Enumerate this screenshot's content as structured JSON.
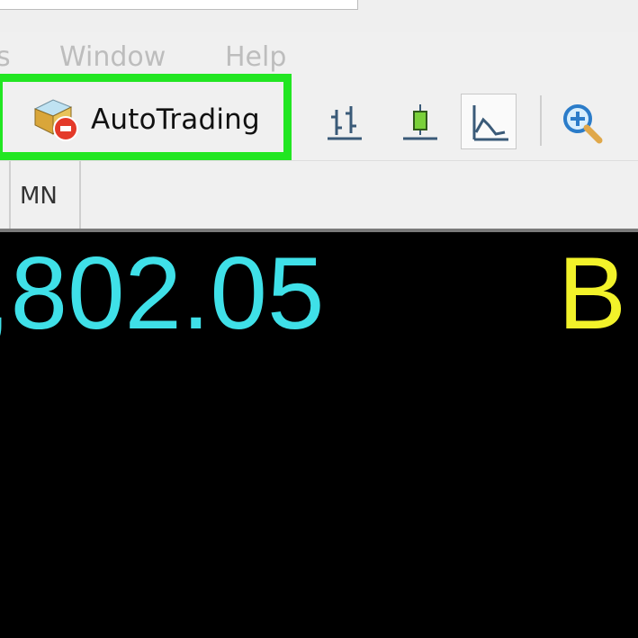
{
  "menu": {
    "items": [
      {
        "label": "s"
      },
      {
        "label": "Window"
      },
      {
        "label": "Help"
      }
    ]
  },
  "toolbar": {
    "autotrading_label": "AutoTrading",
    "tools": [
      {
        "icon": "bar-chart-icon"
      },
      {
        "icon": "candlestick-chart-icon"
      },
      {
        "icon": "line-chart-icon",
        "active": true
      },
      {
        "icon": "zoom-in-icon"
      }
    ]
  },
  "timeframes": {
    "visible": [
      {
        "label": "MN"
      }
    ]
  },
  "chart": {
    "price_text": ",802.05",
    "right_text": "B",
    "colors": {
      "price": "#3fe0e8",
      "right_text": "#f2f22a",
      "highlight_border": "#22e622",
      "background": "#000000"
    }
  }
}
